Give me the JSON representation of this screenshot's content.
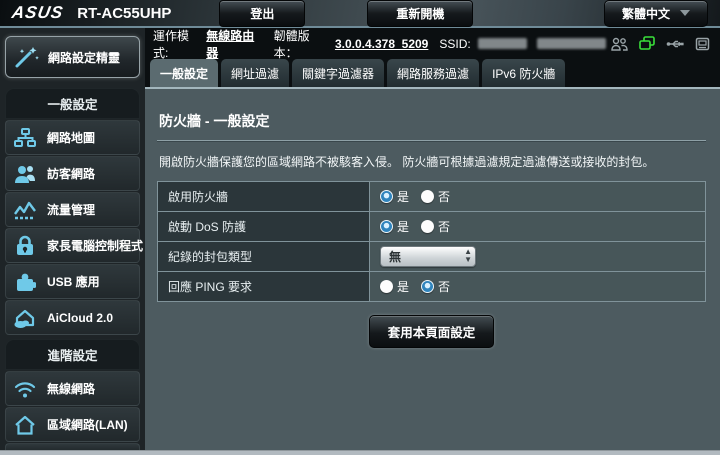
{
  "header": {
    "brand": "ASUS",
    "model": "RT-AC55UHP",
    "logout_label": "登出",
    "reboot_label": "重新開機",
    "language": "繁體中文"
  },
  "infobar": {
    "op_mode_label": "運作模式:",
    "op_mode_value": "無線路由器",
    "firmware_label": "韌體版本：",
    "firmware_value": "3.0.0.4.378_5209",
    "ssid_label": "SSID:"
  },
  "tabs": [
    {
      "label": "一般設定"
    },
    {
      "label": "網址過濾"
    },
    {
      "label": "關鍵字過濾器"
    },
    {
      "label": "網路服務過濾"
    },
    {
      "label": "IPv6 防火牆"
    }
  ],
  "sidebar": {
    "qis_label": "網路設定精靈",
    "sections": [
      {
        "title": "一般設定",
        "items": [
          "網路地圖",
          "訪客網路",
          "流量管理",
          "家長電腦控制程式",
          "USB 應用",
          "AiCloud 2.0"
        ]
      },
      {
        "title": "進階設定",
        "items": [
          "無線網路",
          "區域網路(LAN)"
        ]
      }
    ]
  },
  "content": {
    "title": "防火牆 - 一般設定",
    "description": "開啟防火牆保護您的區域網路不被駭客入侵。 防火牆可根據過濾規定過濾傳送或接收的封包。",
    "yes_label": "是",
    "no_label": "否",
    "rows": [
      {
        "label": "啟用防火牆",
        "value": "yes"
      },
      {
        "label": "啟動 DoS 防護",
        "value": "yes"
      },
      {
        "label": "紀錄的封包類型",
        "value": "無"
      },
      {
        "label": "回應 PING 要求",
        "value": "no"
      }
    ],
    "apply_label": "套用本頁面設定"
  },
  "colors": {
    "accent_blue": "#6fc9e8",
    "radio_selected": "#2f84bd",
    "status_green": "#3ae03a",
    "content_bg": "#4d5b60"
  }
}
